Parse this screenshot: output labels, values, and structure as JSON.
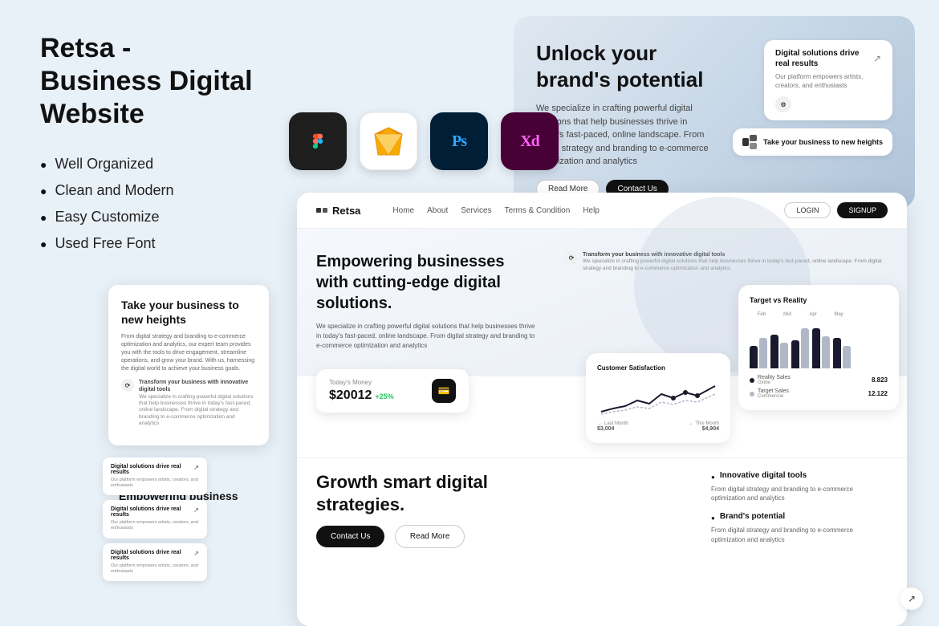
{
  "title": "Retsa - Business Digital Website",
  "left": {
    "title_line1": "Retsa - Business Digital",
    "title_line2": "Website",
    "features": [
      "Well Organized",
      "Clean and Modern",
      "Easy Customize",
      "Used Free Font"
    ]
  },
  "tools": [
    {
      "name": "Figma",
      "label": "Fg",
      "class": "tool-figma"
    },
    {
      "name": "Sketch",
      "label": "S",
      "class": "tool-sketch"
    },
    {
      "name": "Photoshop",
      "label": "Ps",
      "class": "tool-ps"
    },
    {
      "name": "XD",
      "label": "Xd",
      "class": "tool-xd"
    }
  ],
  "hero_card": {
    "title": "Unlock your brand's potential",
    "description": "We specialize in crafting powerful digital solutions that help businesses thrive in today's fast-paced, online landscape. From digital strategy and branding to e-commerce optimization and analytics",
    "btn_read": "Read More",
    "btn_contact": "Contact Us",
    "side_card1_title": "Digital solutions drive real results",
    "side_card1_desc": "Our platform empowers artists, creators, and enthusiasts",
    "side_card2": "Take your business to new heights"
  },
  "navbar": {
    "logo": "Retsa",
    "links": [
      "Home",
      "About",
      "Services",
      "Terms & Condition",
      "Help"
    ],
    "btn_login": "LOGIN",
    "btn_signup": "SIGNUP"
  },
  "hero_section": {
    "title": "Empowering businesses with cutting-edge digital solutions.",
    "description": "We specialize in crafting powerful digital solutions that help businesses thrive in today's fast-paced, online landscape. From digital strategy and branding to e-commerce optimization and analytics",
    "feature_title": "Transform your business with innovative digital tools",
    "feature_desc": "We specialize in crafting powerful digital solutions that help businesses thrive in today's fast-paced, online landscape. From digital strategy and branding to e-commerce optimization and analytics"
  },
  "money_card": {
    "label": "Today's Money",
    "value": "$20012",
    "change": "+25%"
  },
  "satisfaction_card": {
    "title": "Customer Satisfaction",
    "months": [
      "Last Month",
      "This Month"
    ],
    "values": [
      "$3,004",
      "$4,904"
    ]
  },
  "target_card": {
    "title": "Target vs Reality",
    "months": [
      "Feb",
      "Mid",
      "Apr",
      "May"
    ],
    "reality_label": "Reality Sales",
    "reality_sub": "Globe",
    "reality_value": "8.823",
    "target_label": "Target Sales",
    "target_sub": "Commercial",
    "target_value": "12.122"
  },
  "bottom_section": {
    "title_line1": "Growth smart digital",
    "title_line2": "strategies.",
    "btn_contact": "Contact Us",
    "btn_read": "Read More",
    "bullets": [
      {
        "title": "Innovative digital tools",
        "desc": "From digital strategy and branding to e-commerce optimization and analytics"
      },
      {
        "title": "Brand's potential",
        "desc": "From digital strategy and branding to e-commerce optimization and analytics"
      }
    ]
  },
  "left_preview_card": {
    "title": "Take your business to new heights",
    "desc": "From digital strategy and branding to e-commerce optimization and analytics, our expert team provides you with the tools to drive engagement, streamline operations, and grow your brand. With us, harnessing the digital world to achieve your business goals.",
    "feature_title": "Transform your business with innovative digital tools",
    "feature_desc": "We specialize in crafting powerful digital solutions that help businesses thrive in today's fast-paced, online landscape. From digital strategy and branding to e-commerce optimization and analytics"
  },
  "mini_cards": [
    {
      "title": "Digital solutions drive real results",
      "arrow": "↗",
      "desc": "Our platform empowers artists, creators, and enthusiasts"
    },
    {
      "title": "Digital solutions drive real results",
      "arrow": "↗",
      "desc": "Our platform empowers artists, creators, and enthusiasts"
    },
    {
      "title": "Digital solutions drive real results",
      "arrow": "↗",
      "desc": "Our platform empowers artists, creators, and enthusiasts"
    }
  ],
  "emp_section": {
    "title_line1": "Empowering business",
    "title_line2": "digital sol",
    "partial_text": "cutting-edge",
    "partial_text2": "s"
  },
  "corner_arrow_label": "↗"
}
